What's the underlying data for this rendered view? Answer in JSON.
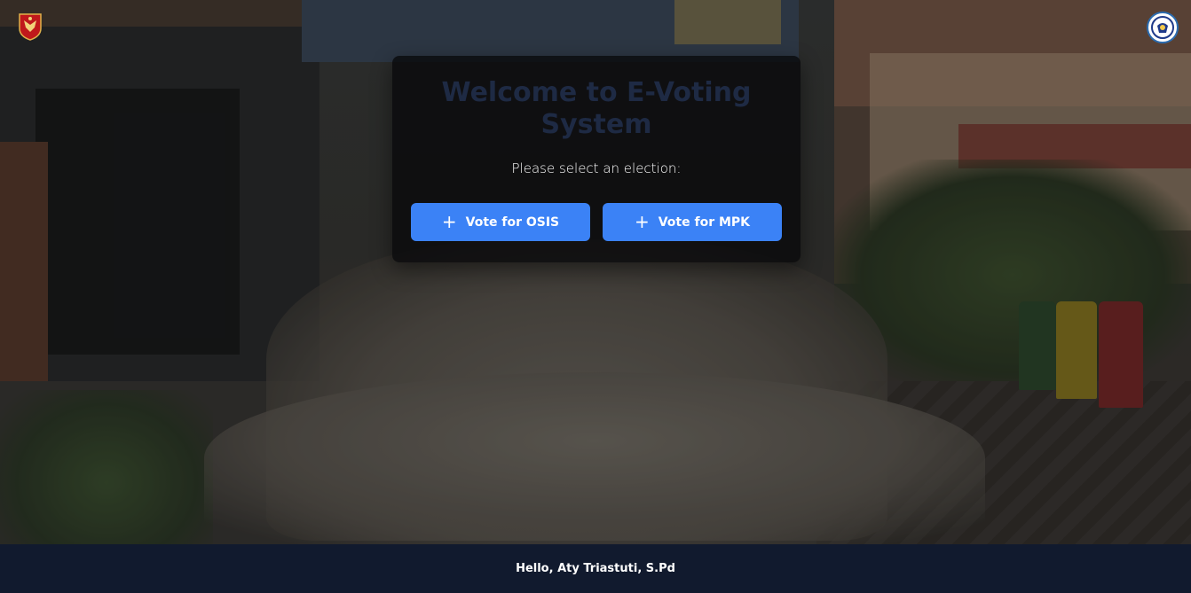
{
  "header": {
    "left_logo": "school-emblem-icon",
    "right_logo": "osis-emblem-icon"
  },
  "card": {
    "title": "Welcome to E-Voting System",
    "subtitle": "Please select an election:",
    "buttons": [
      {
        "icon": "plus-icon",
        "label": "Vote for OSIS"
      },
      {
        "icon": "plus-icon",
        "label": "Vote for MPK"
      }
    ]
  },
  "footer": {
    "greeting": "Hello, Aty Triastuti, S.Pd"
  },
  "colors": {
    "button": "#3b82f6",
    "footer": "#111a2e",
    "title": "#1e2a44",
    "card": "#08080a"
  }
}
